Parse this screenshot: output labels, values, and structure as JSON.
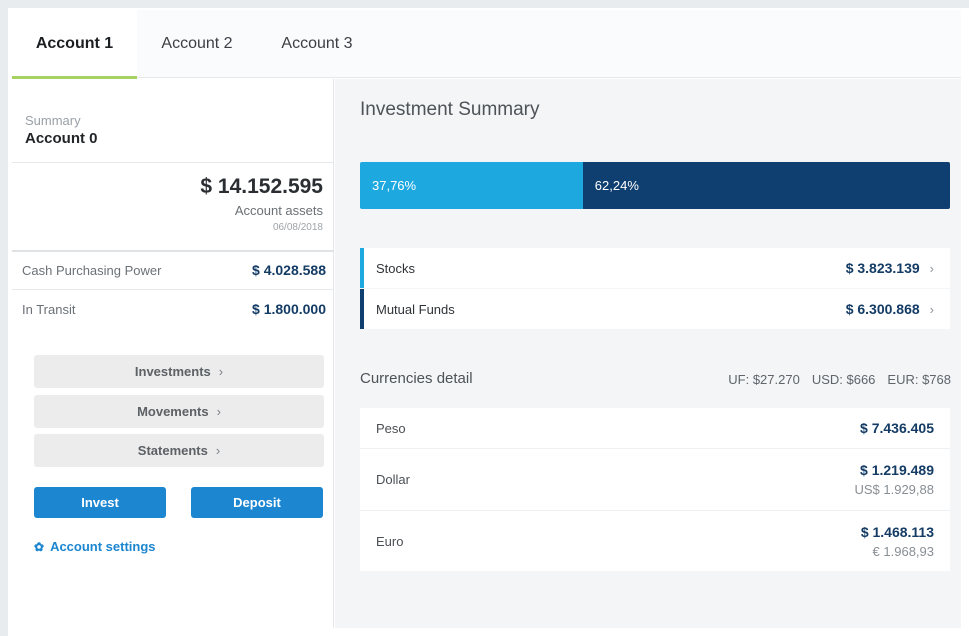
{
  "tabs": [
    {
      "label": "Account 1"
    },
    {
      "label": "Account 2"
    },
    {
      "label": "Account 3"
    }
  ],
  "left": {
    "summary_label": "Summary",
    "account_name": "Account 0",
    "assets_value": "$ 14.152.595",
    "assets_label": "Account assets",
    "assets_date": "06/08/2018",
    "cash_label": "Cash Purchasing Power",
    "cash_value": "$ 4.028.588",
    "transit_label": "In Transit",
    "transit_value": "$ 1.800.000",
    "links": [
      {
        "label": "Investments",
        "chevron": "›"
      },
      {
        "label": "Movements",
        "chevron": "›"
      },
      {
        "label": "Statements",
        "chevron": "›"
      }
    ],
    "invest_label": "Invest",
    "deposit_label": "Deposit",
    "settings_label": "Account settings",
    "settings_icon": "gear-icon"
  },
  "right": {
    "title": "Investment Summary",
    "distribution": [
      {
        "label": "37,76%",
        "fraction": 0.3776,
        "color": "#1ea8e0"
      },
      {
        "label": "62,24%",
        "fraction": 0.6224,
        "color": "#0f3f70"
      }
    ],
    "funds": [
      {
        "label": "Stocks",
        "value": "$ 3.823.139",
        "chevron": "›",
        "color": "#1ea8e0"
      },
      {
        "label": "Mutual Funds",
        "value": "$ 6.300.868",
        "chevron": "›",
        "color": "#0f3f70"
      }
    ],
    "currencies_title": "Currencies detail",
    "rates": [
      "UF: $27.270",
      "USD: $666",
      "EUR: $768"
    ],
    "currencies": [
      {
        "label": "Peso",
        "value": "$ 7.436.405",
        "sub": ""
      },
      {
        "label": "Dollar",
        "value": "$ 1.219.489",
        "sub": "US$ 1.929,88"
      },
      {
        "label": "Euro",
        "value": "$ 1.468.113",
        "sub": "€ 1.968,93"
      }
    ]
  },
  "colors": {
    "accent_blue": "#1c86d0",
    "tab_active_underline": "#a6d163",
    "value_navy": "#133b64"
  }
}
